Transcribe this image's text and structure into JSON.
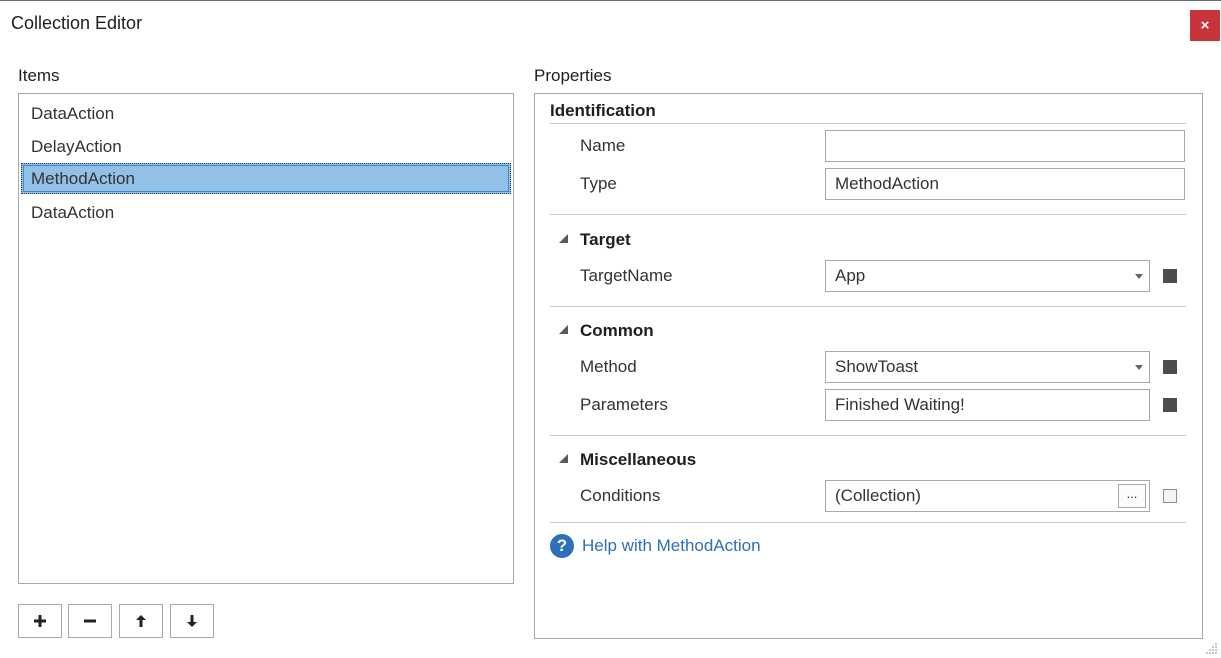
{
  "window": {
    "title": "Collection Editor",
    "close_label": "×"
  },
  "items_panel": {
    "label": "Items",
    "items": [
      "DataAction",
      "DelayAction",
      "MethodAction",
      "DataAction"
    ],
    "selected": "MethodAction"
  },
  "toolbar": {
    "add": "add-icon",
    "remove": "remove-icon",
    "move_up": "arrow-up-icon",
    "move_down": "arrow-down-icon"
  },
  "properties_panel": {
    "label": "Properties",
    "identification": {
      "title": "Identification",
      "name_label": "Name",
      "name_value": "",
      "type_label": "Type",
      "type_value": "MethodAction"
    },
    "target": {
      "title": "Target",
      "target_name_label": "TargetName",
      "target_name_value": "App"
    },
    "common": {
      "title": "Common",
      "method_label": "Method",
      "method_value": "ShowToast",
      "parameters_label": "Parameters",
      "parameters_value": "Finished Waiting!"
    },
    "misc": {
      "title": "Miscellaneous",
      "conditions_label": "Conditions",
      "conditions_value": "(Collection)",
      "ellipsis": "..."
    },
    "help_link": "Help with MethodAction",
    "help_icon_glyph": "?"
  },
  "colors": {
    "selection": "#93c0e6",
    "close_button": "#c7353b",
    "link": "#2d6fb8"
  }
}
